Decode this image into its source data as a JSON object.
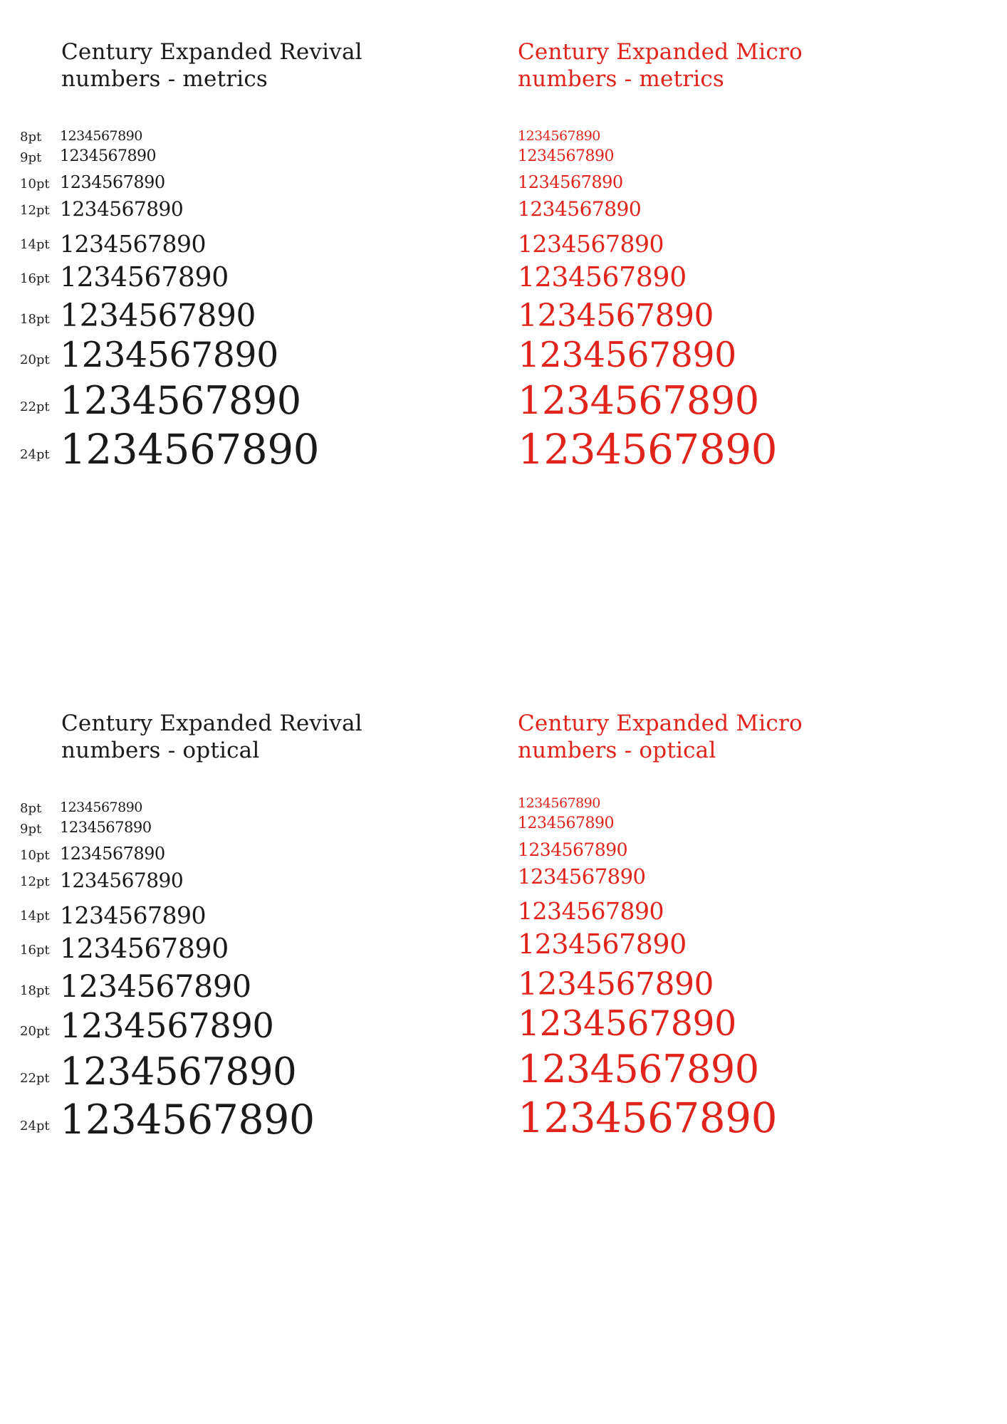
{
  "colors": {
    "revival": "#1a1a1a",
    "micro": "#e0231b"
  },
  "sections": [
    {
      "revival": {
        "title": "Century Expanded Revival",
        "subtitle": "numbers - metrics"
      },
      "micro": {
        "title": "Century Expanded Micro",
        "subtitle": "numbers - metrics"
      }
    },
    {
      "revival": {
        "title": "Century Expanded Revival",
        "subtitle": "numbers - optical"
      },
      "micro": {
        "title": "Century Expanded Micro",
        "subtitle": "numbers - optical"
      }
    }
  ],
  "size_labels": [
    "8pt",
    "9pt",
    "10pt",
    "12pt",
    "14pt",
    "16pt",
    "18pt",
    "20pt",
    "22pt",
    "24pt"
  ],
  "sample_text": "1234567890"
}
